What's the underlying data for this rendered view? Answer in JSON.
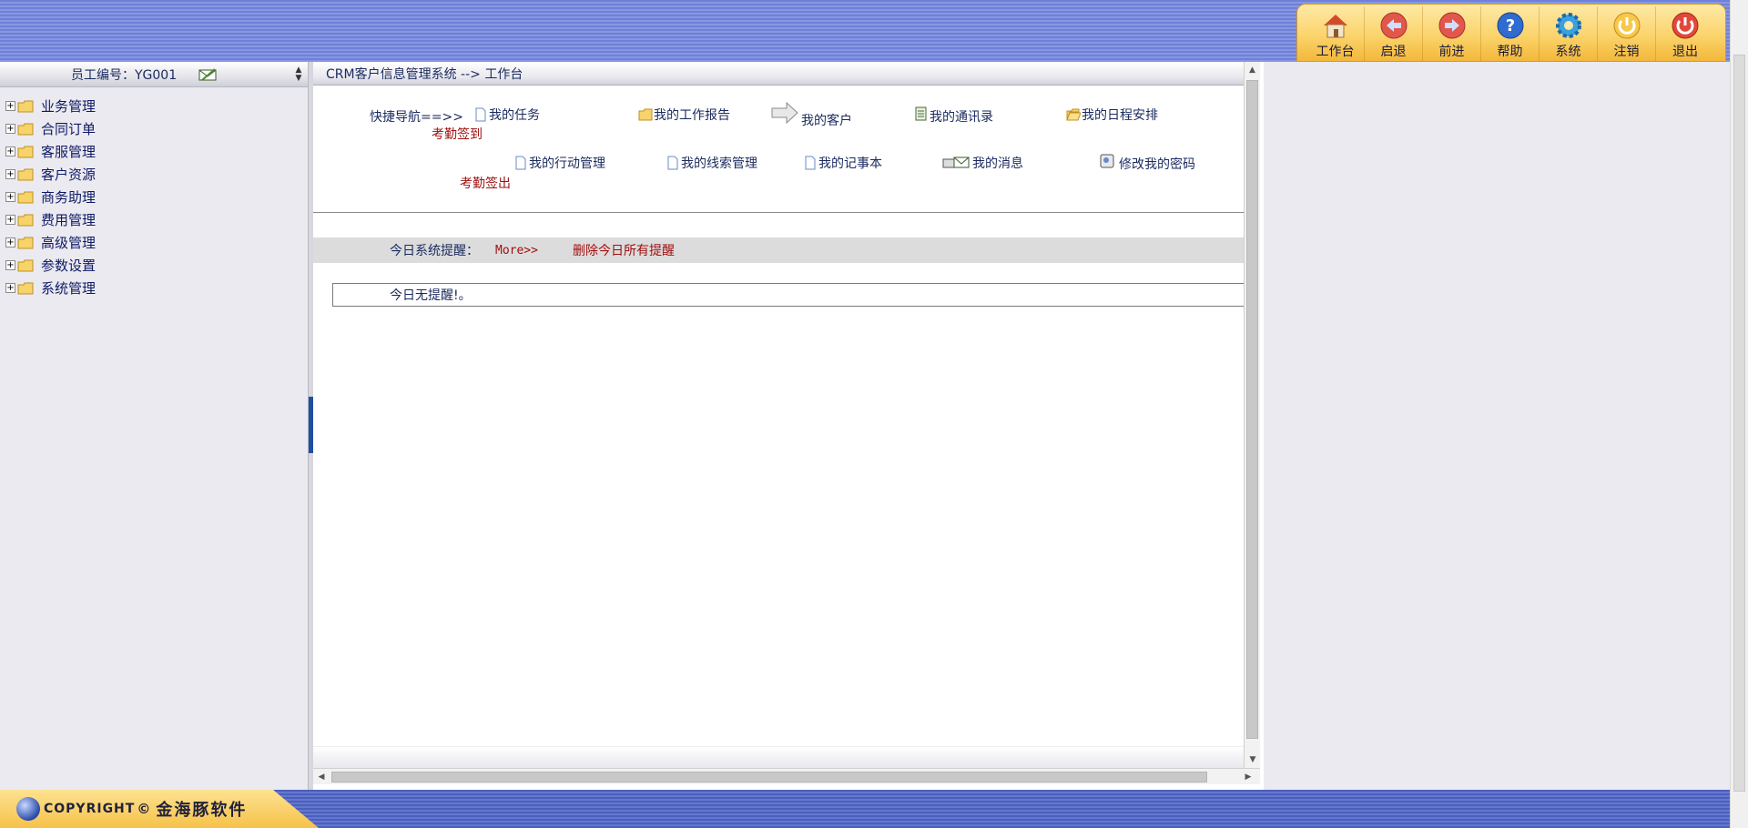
{
  "toolbar": {
    "items": [
      {
        "label": "工作台",
        "icon": "home-icon"
      },
      {
        "label": "启退",
        "icon": "back-icon"
      },
      {
        "label": "前进",
        "icon": "forward-icon"
      },
      {
        "label": "帮助",
        "icon": "help-icon"
      },
      {
        "label": "系统",
        "icon": "gear-icon"
      },
      {
        "label": "注销",
        "icon": "logout-icon"
      },
      {
        "label": "退出",
        "icon": "power-icon"
      }
    ]
  },
  "sidebar": {
    "employee_label": "员工编号：YG001",
    "items": [
      {
        "label": "业务管理"
      },
      {
        "label": "合同订单"
      },
      {
        "label": "客服管理"
      },
      {
        "label": "客户资源"
      },
      {
        "label": "商务助理"
      },
      {
        "label": "费用管理"
      },
      {
        "label": "高级管理"
      },
      {
        "label": "参数设置"
      },
      {
        "label": "系统管理"
      }
    ]
  },
  "main": {
    "breadcrumb": "CRM客户信息管理系统 --> 工作台",
    "quicknav_label": "快捷导航==>>",
    "checkin": "考勤签到",
    "checkout": "考勤签出",
    "links": [
      {
        "label": "我的任务",
        "icon": "document-icon"
      },
      {
        "label": "我的工作报告",
        "icon": "folder-icon"
      },
      {
        "label": "我的客户",
        "icon": "arrow-icon"
      },
      {
        "label": "我的通讯录",
        "icon": "addressbook-icon"
      },
      {
        "label": "我的日程安排",
        "icon": "folder-open-icon"
      },
      {
        "label": "我的行动管理",
        "icon": "document-icon"
      },
      {
        "label": "我的线索管理",
        "icon": "document-icon"
      },
      {
        "label": "我的记事本",
        "icon": "document-icon"
      },
      {
        "label": "我的消息",
        "icon": "message-icon"
      },
      {
        "label": "修改我的密码",
        "icon": "password-icon"
      }
    ],
    "reminder_title": "今日系统提醒：",
    "reminder_more": "More>>",
    "reminder_delete": "删除今日所有提醒",
    "reminder_empty": "今日无提醒!。"
  },
  "footer": {
    "copyright": "COPYRIGHT",
    "symbol": "©",
    "brand": "金海豚软件"
  },
  "colors": {
    "banner_blue": "#6e80d8",
    "toolbar_gold": "#fbd46c",
    "link_text": "#1a2a5e",
    "accent_red": "#a01010"
  }
}
